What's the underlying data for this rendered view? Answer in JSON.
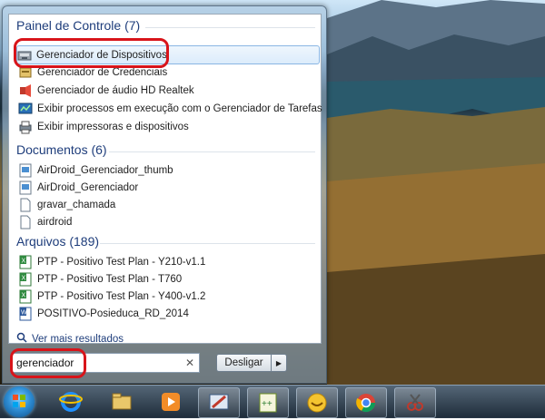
{
  "search": {
    "value": "gerenciador"
  },
  "groups": {
    "painel": {
      "title": "Painel de Controle (7)",
      "items": [
        {
          "label": "Gerenciador de Dispositivos",
          "icon": "device-manager-icon"
        },
        {
          "label": "Gerenciador de Credenciais",
          "icon": "credential-manager-icon"
        },
        {
          "label": "Gerenciador de áudio HD Realtek",
          "icon": "realtek-audio-icon"
        },
        {
          "label": "Exibir processos em execução com o Gerenciador de Tarefas",
          "icon": "task-manager-icon"
        },
        {
          "label": "Exibir impressoras e dispositivos",
          "icon": "printers-icon"
        }
      ]
    },
    "documentos": {
      "title": "Documentos (6)",
      "items": [
        {
          "label": "AirDroid_Gerenciador_thumb",
          "icon": "image-file-icon"
        },
        {
          "label": "AirDroid_Gerenciador",
          "icon": "image-file-icon"
        },
        {
          "label": "gravar_chamada",
          "icon": "document-icon"
        },
        {
          "label": "airdroid",
          "icon": "document-icon"
        }
      ]
    },
    "arquivos": {
      "title": "Arquivos (189)",
      "items": [
        {
          "label": "PTP - Positivo Test Plan - Y210-v1.1",
          "icon": "excel-file-icon"
        },
        {
          "label": "PTP - Positivo Test Plan - T760",
          "icon": "excel-file-icon"
        },
        {
          "label": "PTP - Positivo Test Plan - Y400-v1.2",
          "icon": "excel-file-icon"
        },
        {
          "label": "POSITIVO-Posieduca_RD_2014",
          "icon": "word-file-icon"
        }
      ]
    }
  },
  "more_results": "Ver mais resultados",
  "shutdown": {
    "label": "Desligar"
  },
  "taskbar": {
    "items": [
      {
        "name": "start-orb"
      },
      {
        "name": "internet-explorer-icon"
      },
      {
        "name": "file-explorer-icon"
      },
      {
        "name": "media-player-icon"
      },
      {
        "name": "paint-tool-icon"
      },
      {
        "name": "notepad-plus-plus-icon"
      },
      {
        "name": "chat-app-icon"
      },
      {
        "name": "chrome-icon"
      },
      {
        "name": "snipping-tool-icon"
      }
    ]
  },
  "colors": {
    "highlight_ring": "#d8141a",
    "group_title": "#1e3d7b"
  }
}
